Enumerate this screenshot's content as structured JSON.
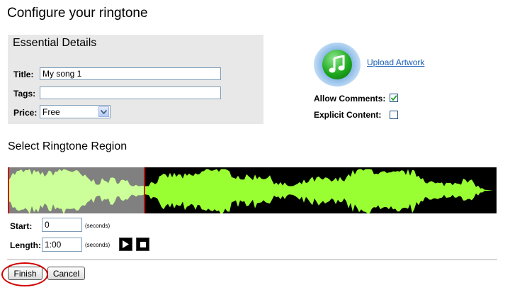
{
  "page": {
    "title": "Configure your ringtone"
  },
  "essential": {
    "heading": "Essential Details",
    "title_label": "Title:",
    "title_value": "My song 1",
    "tags_label": "Tags:",
    "tags_value": "",
    "price_label": "Price:",
    "price_value": "Free"
  },
  "artwork": {
    "upload_label": "Upload Artwork"
  },
  "options": {
    "allow_comments_label": "Allow Comments:",
    "allow_comments_checked": true,
    "explicit_label": "Explicit Content:",
    "explicit_checked": false
  },
  "region": {
    "heading": "Select Ringtone Region",
    "selection_fraction": 0.28,
    "start_label": "Start:",
    "start_value": "0",
    "start_unit": "(seconds)",
    "length_label": "Length:",
    "length_value": "1:00",
    "length_unit": "(seconds)"
  },
  "actions": {
    "finish_label": "Finish",
    "cancel_label": "Cancel"
  },
  "colors": {
    "wave_bright": "#99ff33",
    "wave_selected": "#ccff99",
    "selection_bg": "#808080",
    "selection_border": "#cc0000",
    "highlight_circle": "#d40000"
  }
}
